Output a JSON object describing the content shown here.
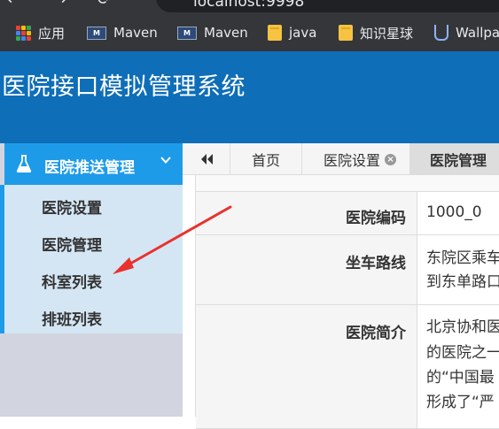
{
  "browser": {
    "url_partial": "localhost:9998",
    "bookmarks": [
      {
        "label": "应用",
        "icon": "apps-grid-icon"
      },
      {
        "label": "Maven",
        "icon": "maven-icon"
      },
      {
        "label": "Maven",
        "icon": "maven-icon"
      },
      {
        "label": "java",
        "icon": "folder-icon"
      },
      {
        "label": "知识星球",
        "icon": "folder-icon"
      },
      {
        "label": "Wallpa",
        "icon": "u-icon"
      }
    ]
  },
  "app": {
    "title": "医院接口模拟管理系统"
  },
  "sidebar": {
    "group_label": "医院推送管理",
    "items": [
      {
        "label": "医院设置"
      },
      {
        "label": "医院管理"
      },
      {
        "label": "科室列表"
      },
      {
        "label": "排班列表"
      }
    ]
  },
  "tabs": [
    {
      "label": "首页"
    },
    {
      "label": "医院设置",
      "closable": true
    },
    {
      "label": "医院管理",
      "active": true
    }
  ],
  "detail": {
    "rows": [
      {
        "label": "医院编码",
        "value_lines": [
          "1000_0"
        ]
      },
      {
        "label": "坐车路线",
        "value_lines": [
          "东院区乘车",
          "到东单路口"
        ]
      },
      {
        "label": "医院简介",
        "value_lines": [
          "北京协和医",
          "的医院之一",
          "的“中国最",
          "形成了“严"
        ]
      }
    ]
  },
  "colors": {
    "header_bg": "#0e6eb8",
    "menu_active": "#1e9be8",
    "annotation_arrow": "#e8322e"
  }
}
